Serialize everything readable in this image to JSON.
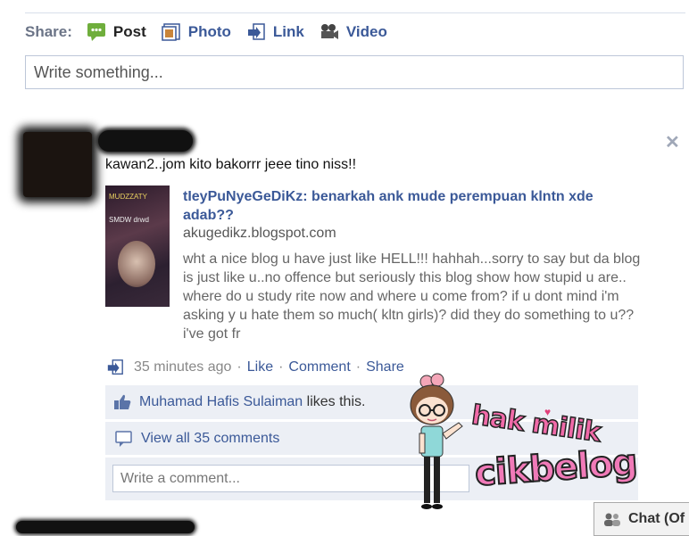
{
  "composer": {
    "share_label": "Share:",
    "options": [
      {
        "label": "Post",
        "icon": "speech-bubble-icon"
      },
      {
        "label": "Photo",
        "icon": "photo-icon"
      },
      {
        "label": "Link",
        "icon": "link-icon"
      },
      {
        "label": "Video",
        "icon": "video-camera-icon"
      }
    ],
    "placeholder": "Write something..."
  },
  "post": {
    "status_text": "kawan2..jom kito bakorrr jeee tino niss!!",
    "link": {
      "title": "tIeyPuNyeGeDiKz: benarkah ank mude perempuan klntn xde adab??",
      "url": "akugedikz.blogspot.com",
      "description": "wht a nice blog u have just like HELL!!! hahhah...sorry to say but da blog is just like u..no offence but seriously this blog show how stupid u are.. where do u study rite now and where u come from? if u dont mind i'm asking y u hate them so much( kltn girls)? did they do something to u??i've got fr",
      "thumb_caption_top": "MUDZZATY",
      "thumb_caption_mid": "SMDW drwd"
    },
    "meta": {
      "time": "35 minutes ago",
      "actions": [
        "Like",
        "Comment",
        "Share"
      ]
    },
    "likes": {
      "name": "Muhamad Hafis Sulaiman",
      "suffix": "likes this."
    },
    "view_comments": "View all 35 comments",
    "comment_placeholder": "Write a comment..."
  },
  "chat": {
    "label": "Chat (Of"
  },
  "watermark": {
    "line1": "hak milik",
    "line2": "cikbelog"
  },
  "colors": {
    "link": "#3b5998",
    "ufi_bg": "#eceff5",
    "border": "#bdc7d8",
    "watermark_pink": "#f06aa8"
  }
}
